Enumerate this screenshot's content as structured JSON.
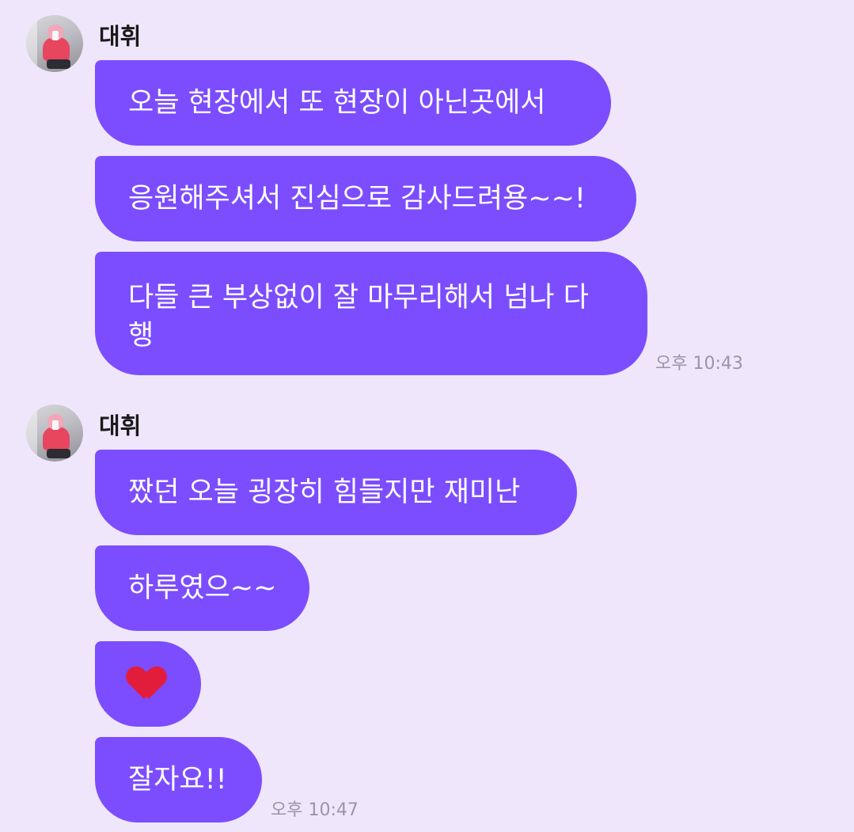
{
  "groups": [
    {
      "sender": "대휘",
      "avatar_icon": "profile-photo",
      "messages": [
        "오늘 현장에서 또 현장이 아닌곳에서",
        "응원해주셔서 진심으로 감사드려용~~!",
        "다들 큰 부상없이 잘 마무리해서 넘나 다행"
      ],
      "time": "오후 10:43"
    },
    {
      "sender": "대휘",
      "avatar_icon": "profile-photo",
      "messages": [
        "짰던 오늘 굉장히 힘들지만 재미난",
        "하루였으~~",
        "❤️",
        "잘자요!!"
      ],
      "time": "오후 10:47"
    }
  ],
  "colors": {
    "background": "#EFE6FC",
    "bubble": "#7B4DFF",
    "bubble_text": "#FFFFFF",
    "time_text": "#9A96A3",
    "heart": "#E21D3C"
  }
}
